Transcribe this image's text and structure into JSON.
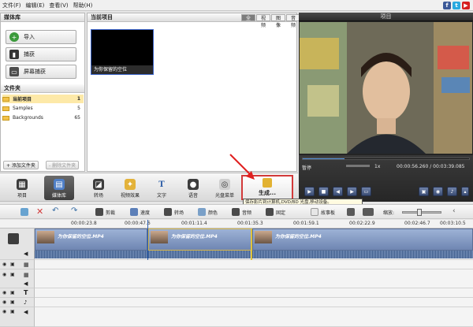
{
  "menubar": {
    "items": [
      "文件(F)",
      "编辑(E)",
      "查看(V)",
      "帮助(H)"
    ]
  },
  "social": {
    "facebook": "f",
    "twitter": "t",
    "youtube": "▶"
  },
  "media_library": {
    "title": "媒体库",
    "import_label": "导入",
    "capture_label": "捕获",
    "screen_capture_label": "屏幕捕获",
    "folders_title": "文件夹",
    "folders": [
      {
        "name": "当前项目",
        "count": "1"
      },
      {
        "name": "Samples",
        "count": "5"
      },
      {
        "name": "Backgrounds",
        "count": "65"
      }
    ],
    "add_folder_label": "+ 添加文件夹",
    "delete_folder_label": "- 删除文件夹"
  },
  "clips_panel": {
    "title": "当前项目",
    "tabs": [
      "全部",
      "视频",
      "图像",
      "音频"
    ],
    "clip_label": "为你保留的空位"
  },
  "preview": {
    "title": "项目",
    "status": "暂停",
    "speed": "1x",
    "time": "00:00:56.260 / 00:03:39.085"
  },
  "toolbar": {
    "items": [
      "项目",
      "媒体库",
      "转场",
      "视频效果",
      "文字",
      "语音",
      "光盘菜单"
    ],
    "produce_label": "生成...",
    "tooltip": "保存影片到计算机,DVD/BD 光盘,移动设备。"
  },
  "timeline_toolbar": {
    "items": [
      "剪裁",
      "速度",
      "转场",
      "颜色",
      "音频",
      "固定",
      "故事板"
    ],
    "zoom_label": "缩放:"
  },
  "ruler": [
    "00:00:23.8",
    "00:00:47.6",
    "00:01:11.4",
    "00:01:35.3",
    "00:01:59.1",
    "00:02:22.9",
    "00:02:46.7",
    "00:03:10.5"
  ],
  "track": {
    "clip_title": "为你保留的空位.MP4"
  },
  "colors": {
    "accent": "#d23a3a",
    "clip_blue": "#6f86b2",
    "dark_panel": "#242424"
  }
}
